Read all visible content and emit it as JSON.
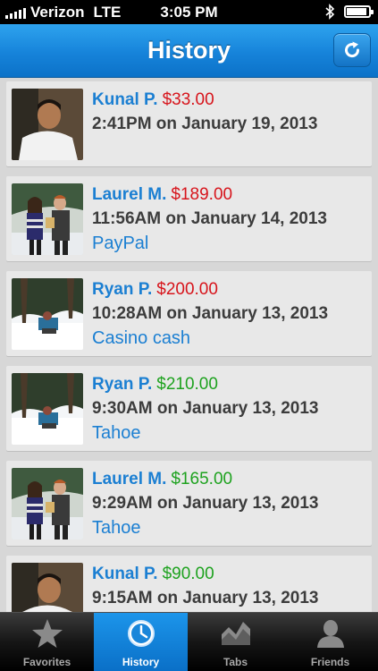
{
  "status": {
    "carrier": "Verizon",
    "network": "LTE",
    "time": "3:05 PM"
  },
  "nav": {
    "title": "History"
  },
  "transactions": [
    {
      "name": "Kunal P.",
      "amount": "$33.00",
      "amount_color": "red",
      "datetime": "2:41PM on January 19, 2013",
      "note": ""
    },
    {
      "name": "Laurel M.",
      "amount": "$189.00",
      "amount_color": "red",
      "datetime": "11:56AM on January 14, 2013",
      "note": "PayPal"
    },
    {
      "name": "Ryan P.",
      "amount": "$200.00",
      "amount_color": "red",
      "datetime": "10:28AM on January 13, 2013",
      "note": "Casino cash"
    },
    {
      "name": "Ryan P.",
      "amount": "$210.00",
      "amount_color": "green",
      "datetime": "9:30AM on January 13, 2013",
      "note": "Tahoe"
    },
    {
      "name": "Laurel M.",
      "amount": "$165.00",
      "amount_color": "green",
      "datetime": "9:29AM on January 13, 2013",
      "note": "Tahoe"
    },
    {
      "name": "Kunal P.",
      "amount": "$90.00",
      "amount_color": "green",
      "datetime": "9:15AM on January 13, 2013",
      "note": ""
    }
  ],
  "tabs": [
    {
      "label": "Favorites",
      "icon": "star-icon"
    },
    {
      "label": "History",
      "icon": "clock-icon"
    },
    {
      "label": "Tabs",
      "icon": "chart-icon"
    },
    {
      "label": "Friends",
      "icon": "person-icon"
    }
  ],
  "colors": {
    "accent": "#1683da",
    "link": "#1b7fd2",
    "amount_out": "#d7141b",
    "amount_in": "#1ea21f"
  }
}
